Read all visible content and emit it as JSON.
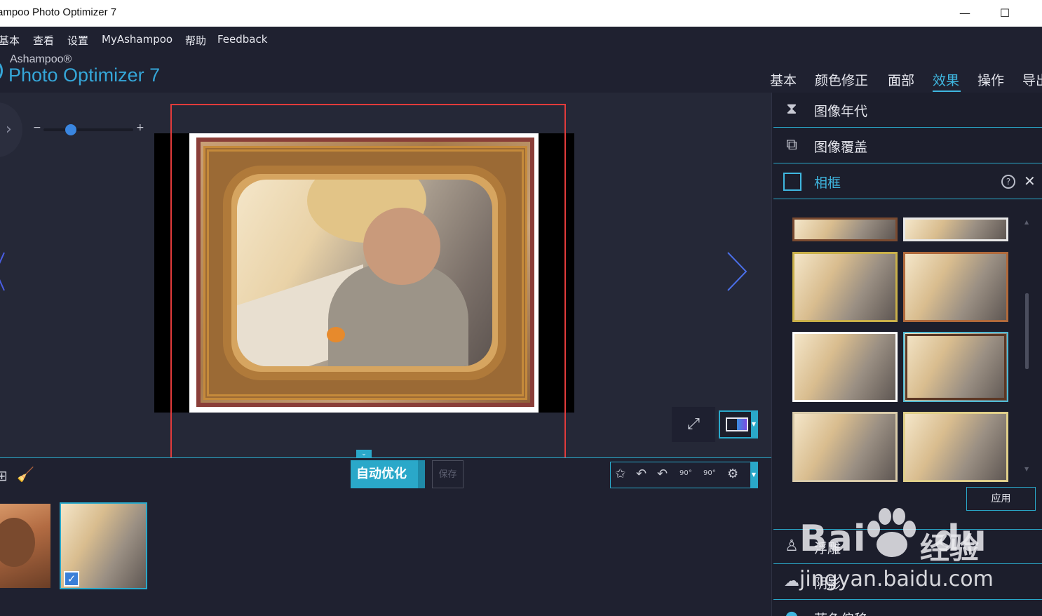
{
  "window": {
    "title": "ampoo Photo Optimizer 7",
    "minimize_glyph": "—",
    "maximize_glyph": "☐"
  },
  "menu": [
    "基本",
    "查看",
    "设置",
    "MyAshampoo",
    "帮助",
    "Feedback"
  ],
  "logo": {
    "brand": "Ashampoo®",
    "product": "Photo Optimizer 7"
  },
  "tabs": [
    {
      "label": "基本",
      "active": false
    },
    {
      "label": "颜色修正",
      "active": false
    },
    {
      "label": "面部",
      "active": false
    },
    {
      "label": "效果",
      "active": true
    },
    {
      "label": "操作",
      "active": false
    },
    {
      "label": "导出",
      "active": false
    }
  ],
  "zoom": {
    "minus": "−",
    "plus": "+",
    "level": 0.3
  },
  "toolbar": {
    "auto_optimize": "自动优化",
    "save": "保存",
    "rotate_left_90": "90°",
    "rotate_right_90": "90°"
  },
  "panel": {
    "items_top": [
      {
        "label": "图像年代",
        "icon": "hourglass-icon"
      },
      {
        "label": "图像覆盖",
        "icon": "overlay-icon"
      },
      {
        "label": "相框",
        "icon": "frame-icon",
        "active": true
      }
    ],
    "help": "?",
    "close": "✕",
    "apply": "应用",
    "items_bottom": [
      {
        "label": "浮雕",
        "icon": "emboss-icon"
      },
      {
        "label": "阴影",
        "icon": "shadow-icon"
      },
      {
        "label": "蓝色偏移",
        "icon": "pin-icon"
      }
    ]
  },
  "watermark": {
    "baidu": "Bai",
    "du": "du",
    "jingyan": "经验",
    "url": "jingyan.baidu.com"
  },
  "colors": {
    "accent": "#2aa8c9",
    "highlight_box": "#e23b3b",
    "background": "#1f2130"
  }
}
